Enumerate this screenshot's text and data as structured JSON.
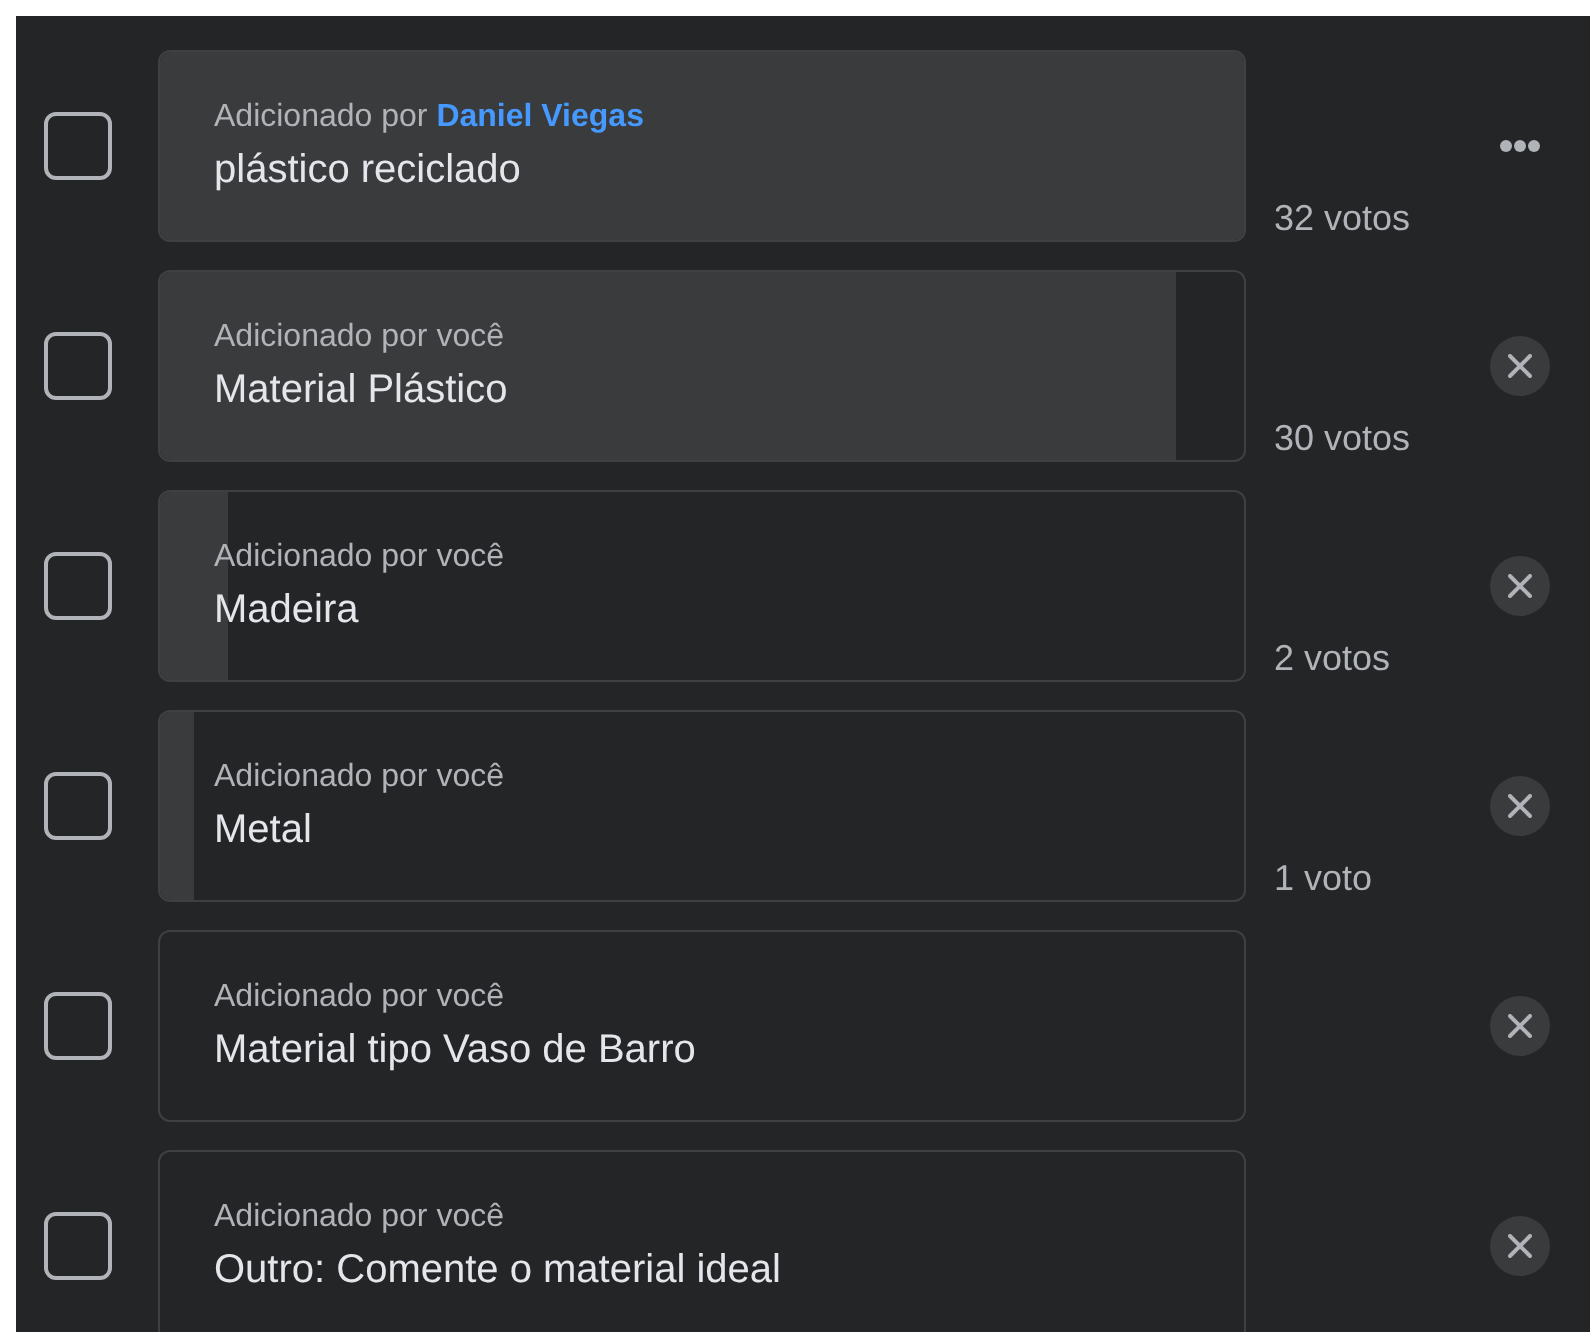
{
  "options": [
    {
      "checked": false,
      "added_by": "Adicionado por",
      "author": "Daniel Viegas",
      "label": "plástico reciclado",
      "level": 1.0,
      "votes": "32 votos",
      "kind": "more"
    },
    {
      "checked": false,
      "added_by": "Adicionado por você",
      "label": "Material Plástico",
      "level": 0.9375,
      "votes": "30 votos",
      "kind": "remove"
    },
    {
      "checked": false,
      "added_by": "Adicionado por você",
      "label": "Madeira",
      "level": 0.0625,
      "votes": "2 votos",
      "kind": "remove"
    },
    {
      "checked": false,
      "added_by": "Adicionado por você",
      "label": "Metal",
      "level": 0.03125,
      "votes": "1 voto",
      "kind": "remove"
    },
    {
      "checked": false,
      "added_by": "Adicionado por você",
      "label": "Material tipo Vaso de Barro",
      "level": 0,
      "kind": "remove"
    },
    {
      "checked": false,
      "added_by": "Adicionado por você",
      "label": "Outro: Comente o material ideal",
      "level": 0,
      "kind": "remove"
    }
  ]
}
